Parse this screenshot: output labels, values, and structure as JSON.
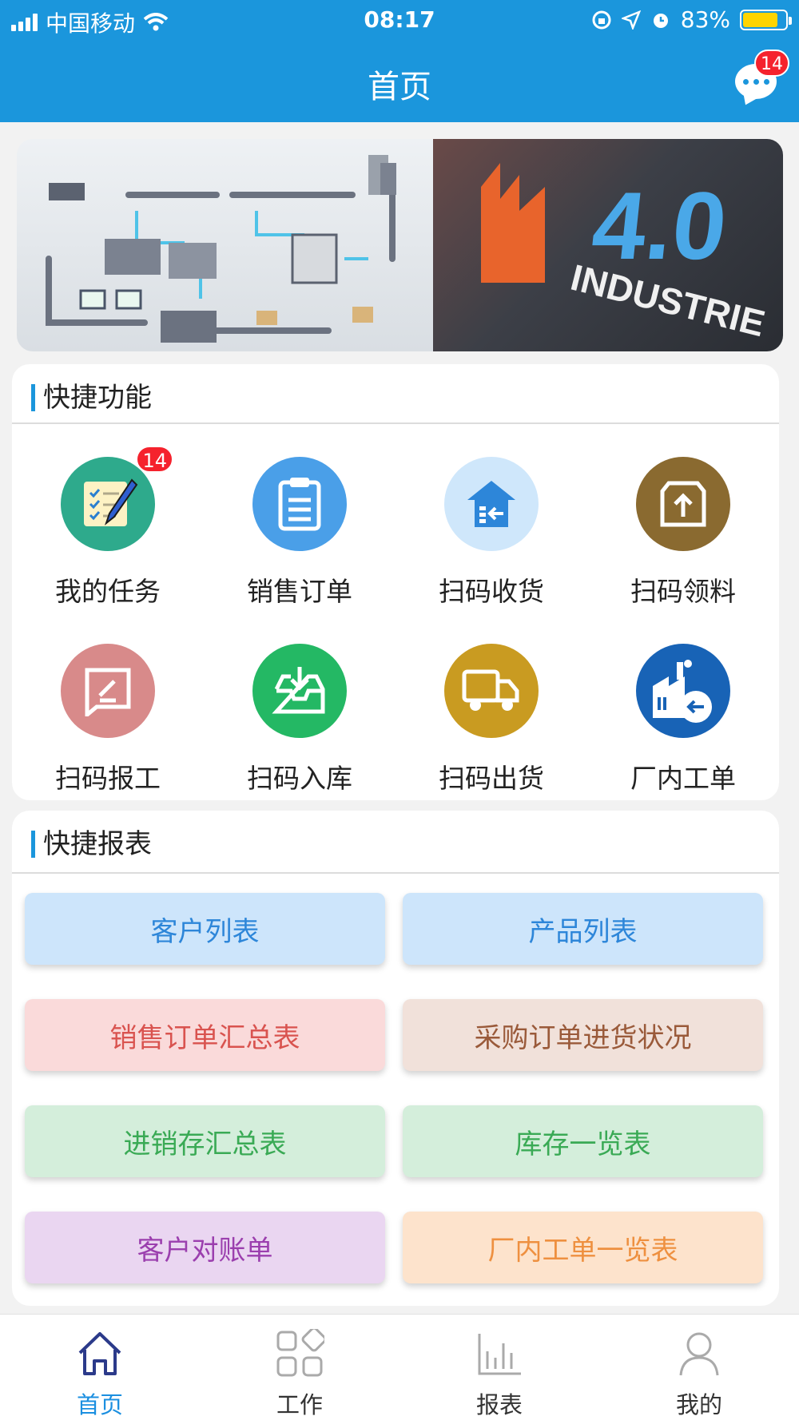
{
  "status_bar": {
    "carrier": "中国移动",
    "time": "08:17",
    "battery": "83%",
    "battery_level": 0.83
  },
  "header": {
    "title": "首页",
    "message_badge": "14"
  },
  "banner": {
    "number": "4.0",
    "word": "INDUSTRIE"
  },
  "quick_functions": {
    "title": "快捷功能",
    "items": [
      {
        "label": "我的任务",
        "icon": "task-list-icon",
        "color": "#2eaa8c",
        "badge": "14"
      },
      {
        "label": "销售订单",
        "icon": "clipboard-icon",
        "color": "#4a9fe8"
      },
      {
        "label": "扫码收货",
        "icon": "warehouse-receive-icon",
        "color": "#cfe7fb"
      },
      {
        "label": "扫码领料",
        "icon": "box-out-icon",
        "color": "#8a6a30"
      },
      {
        "label": "扫码报工",
        "icon": "edit-report-icon",
        "color": "#d88a8a"
      },
      {
        "label": "扫码入库",
        "icon": "inbox-download-icon",
        "color": "#24b864"
      },
      {
        "label": "扫码出货",
        "icon": "truck-icon",
        "color": "#c99b21"
      },
      {
        "label": "厂内工单",
        "icon": "factory-icon",
        "color": "#1863b6"
      }
    ]
  },
  "quick_reports": {
    "title": "快捷报表",
    "buttons": [
      {
        "label": "客户列表",
        "bg": "#cde5fb",
        "fg": "#2d86d9"
      },
      {
        "label": "产品列表",
        "bg": "#cde5fb",
        "fg": "#2d86d9"
      },
      {
        "label": "销售订单汇总表",
        "bg": "#fadada",
        "fg": "#d9534f"
      },
      {
        "label": "采购订单进货状况",
        "bg": "#f1e1da",
        "fg": "#9a5a3a"
      },
      {
        "label": "进销存汇总表",
        "bg": "#d4eedb",
        "fg": "#3aaa55"
      },
      {
        "label": "库存一览表",
        "bg": "#d4eedb",
        "fg": "#3aaa55"
      },
      {
        "label": "客户对账单",
        "bg": "#ead6f1",
        "fg": "#9b3fae"
      },
      {
        "label": "厂内工单一览表",
        "bg": "#fde3cc",
        "fg": "#ee9040"
      }
    ]
  },
  "tabbar": {
    "tabs": [
      {
        "label": "首页",
        "icon": "home-icon",
        "active": true
      },
      {
        "label": "工作",
        "icon": "apps-grid-icon",
        "active": false
      },
      {
        "label": "报表",
        "icon": "bar-chart-icon",
        "active": false
      },
      {
        "label": "我的",
        "icon": "user-icon",
        "active": false
      }
    ]
  }
}
